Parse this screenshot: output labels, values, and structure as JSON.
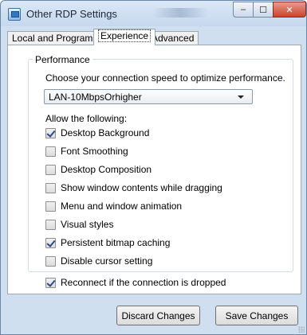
{
  "window": {
    "title": "Other RDP Settings",
    "caption_buttons": {
      "minimize": "–",
      "maximize": "☐",
      "close": "✕"
    }
  },
  "tabs": [
    {
      "label": "Local and Program",
      "selected": false
    },
    {
      "label": "Experience",
      "selected": true
    },
    {
      "label": "Advanced",
      "selected": false
    }
  ],
  "performance": {
    "group_title": "Performance",
    "prompt": "Choose your connection speed to optimize performance.",
    "speed_value": "LAN-10MbpsOrhigher",
    "allow_label": "Allow the following:",
    "options": [
      {
        "label": "Desktop Background",
        "checked": true
      },
      {
        "label": "Font Smoothing",
        "checked": false
      },
      {
        "label": "Desktop Composition",
        "checked": false
      },
      {
        "label": "Show window contents while dragging",
        "checked": false
      },
      {
        "label": "Menu and window animation",
        "checked": false
      },
      {
        "label": "Visual styles",
        "checked": false
      },
      {
        "label": "Persistent bitmap caching",
        "checked": true
      },
      {
        "label": "Disable cursor setting",
        "checked": false
      }
    ]
  },
  "reconnect": {
    "label": "Reconnect if the connection is dropped",
    "checked": true
  },
  "buttons": {
    "discard": "Discard Changes",
    "save": "Save Changes"
  }
}
